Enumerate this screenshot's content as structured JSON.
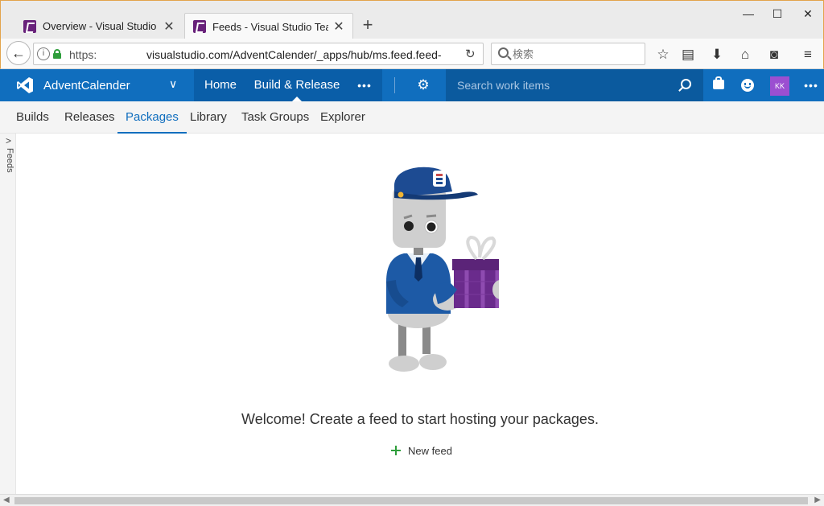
{
  "browser": {
    "tabs": [
      {
        "title": "Overview - Visual Studio T...",
        "active": false
      },
      {
        "title": "Feeds - Visual Studio Tea...",
        "active": true
      }
    ],
    "new_tab": "+",
    "window_controls": {
      "minimize": "—",
      "maximize": "☐",
      "close": "✕"
    },
    "url": {
      "scheme": "https:",
      "host": "visualstudio.com/AdventCalender/_apps/hub/ms.feed.feed-"
    },
    "search_placeholder": "検索"
  },
  "vsts": {
    "project": "AdventCalender",
    "tabs": {
      "home": "Home",
      "build_release": "Build & Release",
      "more": "•••"
    },
    "search_placeholder": "Search work items",
    "avatar_initials": "KK",
    "more": "•••"
  },
  "subnav": {
    "items": [
      "Builds",
      "Releases",
      "Packages",
      "Library",
      "Task Groups",
      "Explorer"
    ],
    "active": "Packages"
  },
  "side_panel": {
    "label": "Feeds"
  },
  "main": {
    "welcome": "Welcome! Create a feed to start hosting your packages.",
    "new_feed_label": "New feed"
  },
  "colors": {
    "accent": "#106ebe",
    "active_tab": "#0a5ea8",
    "plus": "#2e9e3b",
    "avatar": "#9b4fd1"
  }
}
